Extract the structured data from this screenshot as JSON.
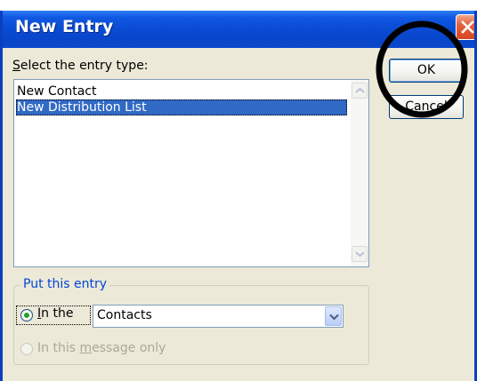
{
  "dialog": {
    "title": "New Entry",
    "close_icon": "close-x-icon"
  },
  "entry_type": {
    "label_accel": "S",
    "label_rest": "elect the entry type:",
    "items": [
      {
        "label": "New Contact",
        "selected": false
      },
      {
        "label": "New Distribution List",
        "selected": true
      }
    ]
  },
  "put_entry": {
    "legend": "Put this entry",
    "in_the": {
      "prefix": "",
      "accel": "I",
      "rest": "n the",
      "checked": true
    },
    "folder_value": "Contacts",
    "message_only": {
      "prefix": "In this ",
      "accel": "m",
      "rest": "essage only",
      "enabled": false
    }
  },
  "buttons": {
    "ok": "OK",
    "cancel": "Cancel"
  },
  "annotation": {
    "shape": "circle",
    "color": "#000000",
    "target": "OK"
  },
  "colors": {
    "title_bar": "#0a4bd3",
    "selection": "#316ac5",
    "legend_text": "#0046d5",
    "dialog_bg": "#ece9d8"
  }
}
